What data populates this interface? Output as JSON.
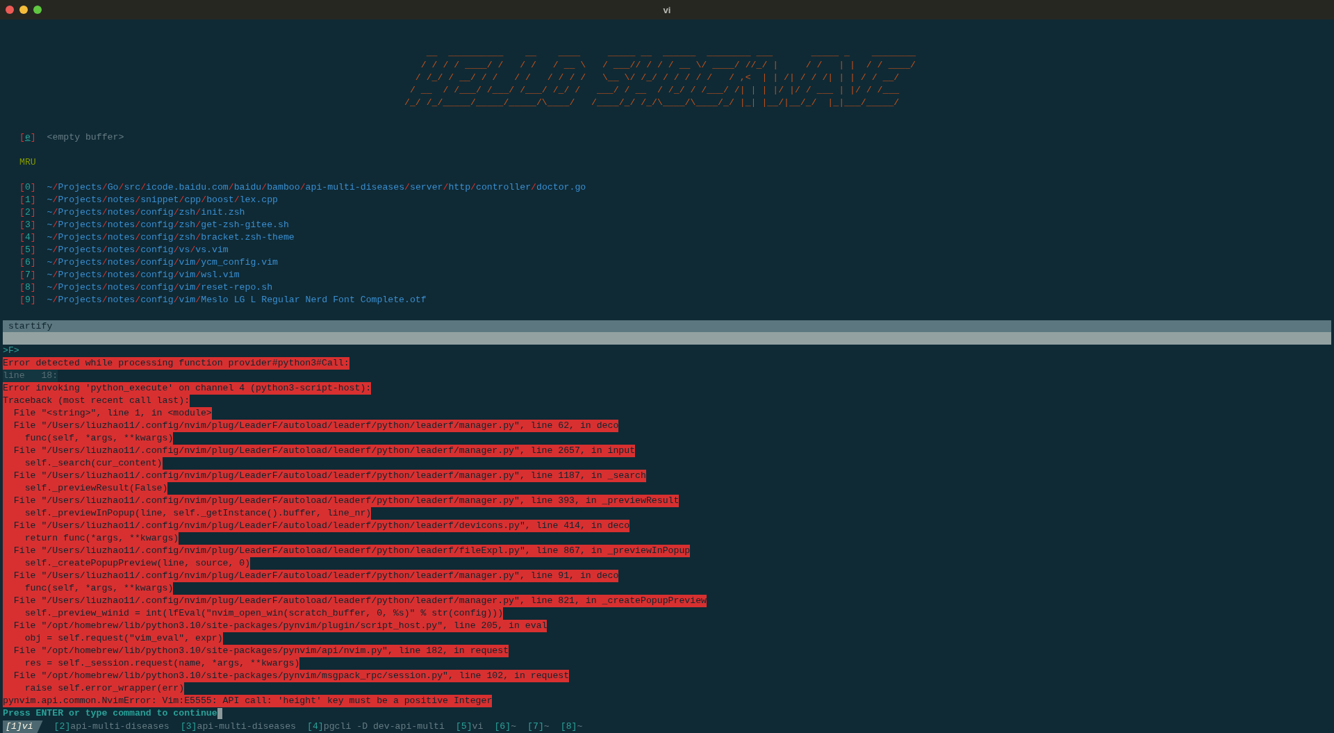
{
  "window": {
    "title": "vi"
  },
  "banner": [
    "    __  __________    __    ____     _____ __  ______  ________ ___       _____ _    ________",
    "   / / / / ____/ /   / /   / __ \\   / ___// / / / __ \\/ ____/ //_/ |     / /   | |  / / ____/",
    "  / /_/ / __/ / /   / /   / / / /   \\__ \\/ /_/ / / / / /   / ,<  | | /| / / /| | | / / __/",
    " / __  / /___/ /___/ /___/ /_/ /   ___/ / __  / /_/ / /___/ /| | | |/ |/ / ___ | |/ / /___",
    "/_/ /_/_____/_____/_____/\\____/   /____/_/ /_/\\____/\\____/_/ |_| |__/|__/_/  |_|___/_____/"
  ],
  "startify": {
    "empty_buffer": {
      "key": "[e]",
      "label": "<empty buffer>"
    },
    "section": "MRU",
    "files": [
      {
        "key": "[0]",
        "path": "~/Projects/Go/src/icode.baidu.com/baidu/bamboo/api-multi-diseases/server/http/controller/doctor.go"
      },
      {
        "key": "[1]",
        "path": "~/Projects/notes/snippet/cpp/boost/lex.cpp"
      },
      {
        "key": "[2]",
        "path": "~/Projects/notes/config/zsh/init.zsh"
      },
      {
        "key": "[3]",
        "path": "~/Projects/notes/config/zsh/get-zsh-gitee.sh"
      },
      {
        "key": "[4]",
        "path": "~/Projects/notes/config/zsh/bracket.zsh-theme"
      },
      {
        "key": "[5]",
        "path": "~/Projects/notes/config/vs/vs.vim"
      },
      {
        "key": "[6]",
        "path": "~/Projects/notes/config/vim/ycm_config.vim"
      },
      {
        "key": "[7]",
        "path": "~/Projects/notes/config/vim/wsl.vim"
      },
      {
        "key": "[8]",
        "path": "~/Projects/notes/config/vim/reset-repo.sh"
      },
      {
        "key": "[9]",
        "path": "~/Projects/notes/config/vim/Meslo LG L Regular Nerd Font Complete.otf"
      }
    ]
  },
  "statusline": {
    "name": "startify"
  },
  "messages": [
    {
      "kind": "prompt",
      "text": ">F>"
    },
    {
      "kind": "error",
      "text": "Error detected while processing function provider#python3#Call:"
    },
    {
      "kind": "linenr",
      "text": "line   18:"
    },
    {
      "kind": "error",
      "text": "Error invoking 'python_execute' on channel 4 (python3-script-host):"
    },
    {
      "kind": "error",
      "text": "Traceback (most recent call last):"
    },
    {
      "kind": "error",
      "text": "  File \"<string>\", line 1, in <module>"
    },
    {
      "kind": "error",
      "text": "  File \"/Users/liuzhao11/.config/nvim/plug/LeaderF/autoload/leaderf/python/leaderf/manager.py\", line 62, in deco"
    },
    {
      "kind": "error",
      "text": "    func(self, *args, **kwargs)"
    },
    {
      "kind": "error",
      "text": "  File \"/Users/liuzhao11/.config/nvim/plug/LeaderF/autoload/leaderf/python/leaderf/manager.py\", line 2657, in input"
    },
    {
      "kind": "error",
      "text": "    self._search(cur_content)"
    },
    {
      "kind": "error",
      "text": "  File \"/Users/liuzhao11/.config/nvim/plug/LeaderF/autoload/leaderf/python/leaderf/manager.py\", line 1187, in _search"
    },
    {
      "kind": "error",
      "text": "    self._previewResult(False)"
    },
    {
      "kind": "error",
      "text": "  File \"/Users/liuzhao11/.config/nvim/plug/LeaderF/autoload/leaderf/python/leaderf/manager.py\", line 393, in _previewResult"
    },
    {
      "kind": "error",
      "text": "    self._previewInPopup(line, self._getInstance().buffer, line_nr)"
    },
    {
      "kind": "error",
      "text": "  File \"/Users/liuzhao11/.config/nvim/plug/LeaderF/autoload/leaderf/python/leaderf/devicons.py\", line 414, in deco"
    },
    {
      "kind": "error",
      "text": "    return func(*args, **kwargs)"
    },
    {
      "kind": "error",
      "text": "  File \"/Users/liuzhao11/.config/nvim/plug/LeaderF/autoload/leaderf/python/leaderf/fileExpl.py\", line 867, in _previewInPopup"
    },
    {
      "kind": "error",
      "text": "    self._createPopupPreview(line, source, 0)"
    },
    {
      "kind": "error",
      "text": "  File \"/Users/liuzhao11/.config/nvim/plug/LeaderF/autoload/leaderf/python/leaderf/manager.py\", line 91, in deco"
    },
    {
      "kind": "error",
      "text": "    func(self, *args, **kwargs)"
    },
    {
      "kind": "error",
      "text": "  File \"/Users/liuzhao11/.config/nvim/plug/LeaderF/autoload/leaderf/python/leaderf/manager.py\", line 821, in _createPopupPreview"
    },
    {
      "kind": "error",
      "text": "    self._preview_winid = int(lfEval(\"nvim_open_win(scratch_buffer, 0, %s)\" % str(config)))"
    },
    {
      "kind": "error",
      "text": "  File \"/opt/homebrew/lib/python3.10/site-packages/pynvim/plugin/script_host.py\", line 205, in eval"
    },
    {
      "kind": "error",
      "text": "    obj = self.request(\"vim_eval\", expr)"
    },
    {
      "kind": "error",
      "text": "  File \"/opt/homebrew/lib/python3.10/site-packages/pynvim/api/nvim.py\", line 182, in request"
    },
    {
      "kind": "error",
      "text": "    res = self._session.request(name, *args, **kwargs)"
    },
    {
      "kind": "error",
      "text": "  File \"/opt/homebrew/lib/python3.10/site-packages/pynvim/msgpack_rpc/session.py\", line 102, in request"
    },
    {
      "kind": "error",
      "text": "    raise self.error_wrapper(err)"
    },
    {
      "kind": "error",
      "text": "pynvim.api.common.NvimError: Vim:E5555: API call: 'height' key must be a positive Integer"
    },
    {
      "kind": "more",
      "text": "Press ENTER or type command to continue"
    }
  ],
  "tabs": [
    {
      "index": "[1]",
      "title": "vi",
      "selected": true
    },
    {
      "index": "[2]",
      "title": "api-multi-diseases",
      "selected": false
    },
    {
      "index": "[3]",
      "title": "api-multi-diseases",
      "selected": false
    },
    {
      "index": "[4]",
      "title": "pgcli -D dev-api-multi",
      "selected": false
    },
    {
      "index": "[5]",
      "title": "vi",
      "selected": false
    },
    {
      "index": "[6]",
      "title": "~",
      "selected": false
    },
    {
      "index": "[7]",
      "title": "~",
      "selected": false
    },
    {
      "index": "[8]",
      "title": "~",
      "selected": false
    }
  ]
}
